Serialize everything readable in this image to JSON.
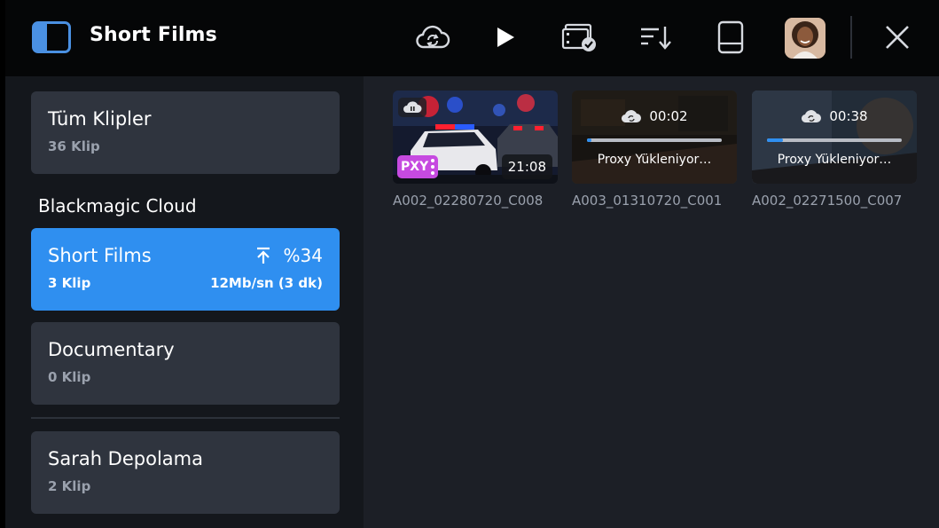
{
  "header": {
    "title": "Short Films",
    "icons": [
      "sidebar-toggle-icon",
      "cloud-sync-icon",
      "play-icon",
      "media-select-icon",
      "sort-icon",
      "drive-icon",
      "avatar",
      "close-icon"
    ]
  },
  "sidebar": {
    "all_clips": {
      "name": "Tüm Klipler",
      "count": "36 Klip"
    },
    "section_label": "Blackmagic Cloud",
    "projects": [
      {
        "name": "Short Films",
        "count": "3 Klip",
        "progress": "%34",
        "rate": "12Mb/sn (3 dk)",
        "active": true
      },
      {
        "name": "Documentary",
        "count": "0 Klip",
        "active": false
      }
    ],
    "storage": {
      "name": "Sarah Depolama",
      "count": "2 Klip"
    }
  },
  "clips": [
    {
      "name": "A002_02280720_C008",
      "badge": "PXY",
      "duration": "21:08",
      "state": "paused"
    },
    {
      "name": "A003_01310720_C001",
      "upload_time": "00:02",
      "upload_label": "Proxy Yükleniyor…",
      "progress": 0.03
    },
    {
      "name": "A002_02271500_C007",
      "upload_time": "00:38",
      "upload_label": "Proxy Yükleniyor…",
      "progress": 0.12
    }
  ],
  "colors": {
    "accent": "#2f8ff0",
    "proxy_badge": "#c64ae0",
    "card": "#2f343e"
  }
}
